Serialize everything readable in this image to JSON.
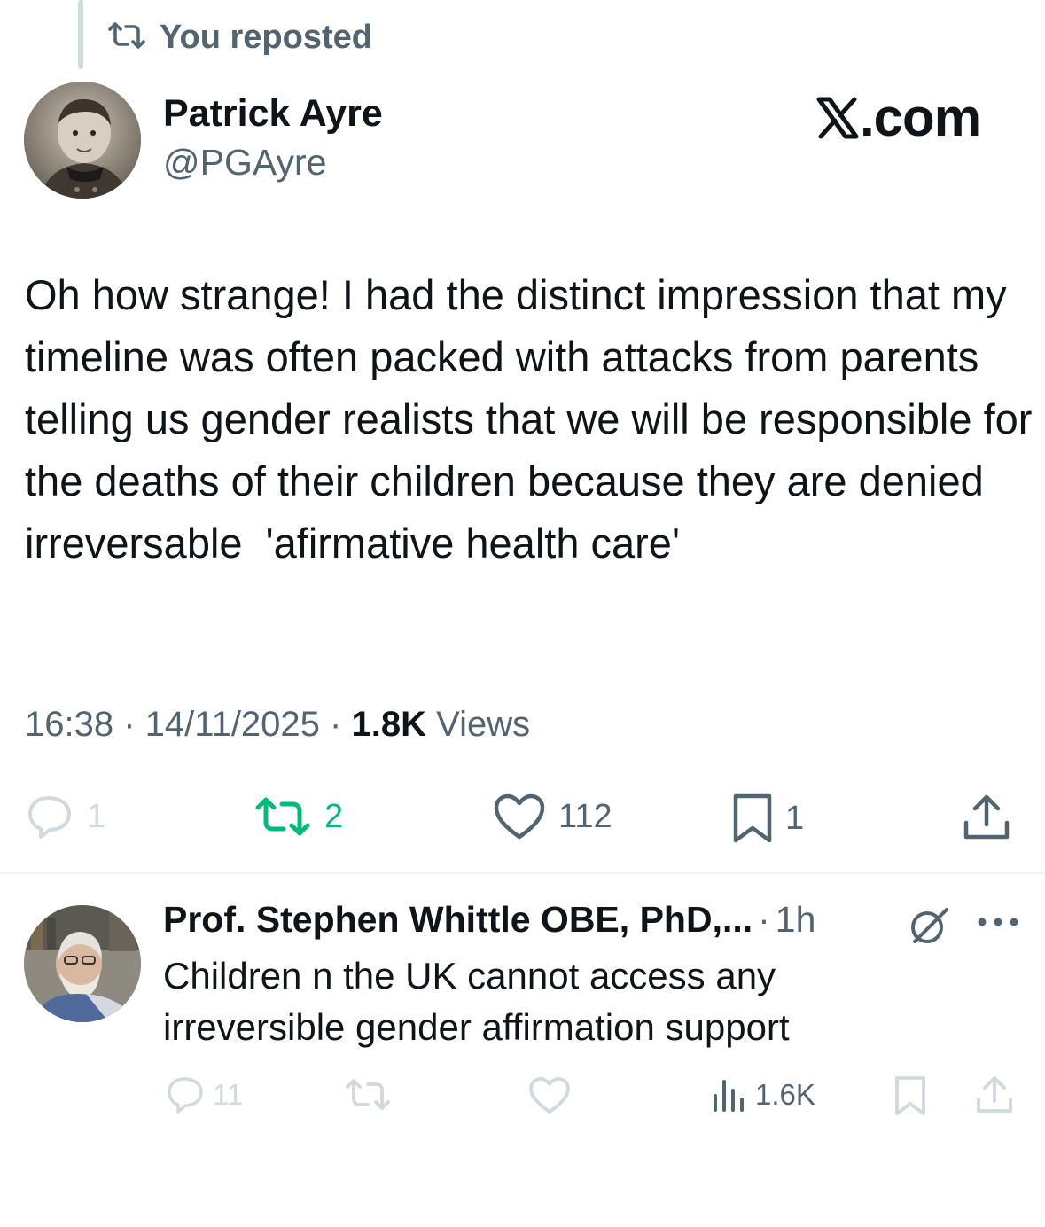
{
  "repost": {
    "label": "You reposted"
  },
  "tweet": {
    "author_name": "Patrick Ayre",
    "author_handle": "@PGAyre",
    "brand": "X.com",
    "text": "Oh how strange! I had the distinct impression that my timeline was often packed with attacks from parents telling us gender realists that we will be responsible for the deaths of their children because they are denied irreversable  'afirmative health care'",
    "time": "16:38",
    "separator": "·",
    "date": "14/11/2025",
    "views_count": "1.8K",
    "views_label": "Views",
    "actions": {
      "replies": "1",
      "reposts": "2",
      "likes": "112",
      "bookmarks": "1"
    }
  },
  "reply": {
    "author_name": "Prof. Stephen Whittle OBE, PhD,...",
    "time_sep": "·",
    "time": "1h",
    "text": "Children n the UK cannot access any irreversible gender affirmation support",
    "actions": {
      "replies": "11",
      "views": "1.6K"
    }
  },
  "colors": {
    "text_primary": "#0f1419",
    "text_secondary": "#536471",
    "repost_active": "#00ba7c",
    "divider": "#eff3f4",
    "muted_icon": "#cfd9de"
  },
  "icons": [
    "repost-icon",
    "x-logo-icon",
    "reply-icon",
    "like-icon",
    "bookmark-icon",
    "share-icon",
    "views-icon",
    "grok-icon",
    "more-icon"
  ]
}
